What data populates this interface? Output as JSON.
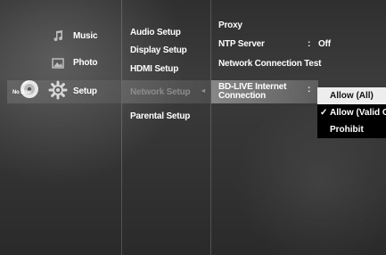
{
  "main_menu": [
    {
      "label": "Music",
      "icon": "music-note-icon"
    },
    {
      "label": "Photo",
      "icon": "photo-icon"
    },
    {
      "label": "Setup",
      "icon": "gear-icon"
    }
  ],
  "disc_status": "No Disc",
  "setup_menu": [
    "Audio Setup",
    "Display Setup",
    "HDMI Setup",
    "Network Setup",
    "Parental Setup"
  ],
  "setup_arrow": "◂",
  "network_options": [
    {
      "label": "Proxy"
    },
    {
      "label": "NTP Server",
      "separator": ":",
      "value": "Off"
    },
    {
      "label": "Network Connection Test"
    },
    {
      "label_line1": "BD-LIVE Internet",
      "label_line2": "Connection",
      "separator": ":"
    }
  ],
  "dropdown": {
    "items": [
      "Allow (All)",
      "Allow (Valid Only)",
      "Prohibit"
    ],
    "highlighted": "Allow (All)",
    "checked": "Allow (Valid Only)",
    "check_mark": "✓"
  },
  "colors": {
    "text": "#ffffff",
    "dim_text": "#8c8c8c",
    "dropdown_bg": "#000000",
    "dropdown_highlight": "#ededed"
  }
}
